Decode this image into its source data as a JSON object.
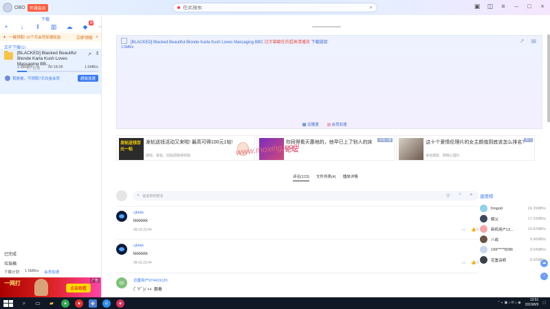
{
  "titlebar": {
    "username": "OBO",
    "vip_badge": "开通会员",
    "search_placeholder": "在此搜索"
  },
  "sidebar": {
    "top_tab": "下载",
    "notice": {
      "text": "一键领取! 10个月会员加速权益",
      "button": "立即领取"
    },
    "section_title": "正在下载(1)",
    "download": {
      "name": "[BLACKED] Blacked Beautiful Blonde Karla Kush Loves Massaging BB...",
      "size": "2.99GB",
      "count": "1个任务",
      "time": "00:18:28",
      "speed": "1.5MB/s",
      "progress": 0.12,
      "promo": "我是被，可领取7天白金会员",
      "accel_button": "超级加速"
    },
    "links": [
      "已完成",
      "垃圾箱"
    ],
    "footer": {
      "plan": "下载计划",
      "speed": "1.5MB/s",
      "vip": "会员加速"
    },
    "ad": {
      "brand": "一网打",
      "button": "点击观看",
      "badge": "广告"
    }
  },
  "player": {
    "title_prefix": "[BLACKED] Blacked Beautiful Blonde Karla Kush Loves Massaging BBC",
    "title_suffix": "比字幕翻在的超高清播放",
    "title_link": "下载链接",
    "speed": "1.5MB/s",
    "legend": [
      "远播速",
      "会员加速"
    ]
  },
  "cards": [
    {
      "title": "发帖送钱活动又来啦! 最高可得100元1帖!",
      "meta": "游戏、看帖、回帖即能得奖励",
      "thumb_text": "发帖送钱百元一帖",
      "flag": ""
    },
    {
      "title": "你同得看天惠地的，他早已上了别人的床",
      "meta": "",
      "thumb_text": "",
      "flag": "天龙八部"
    },
    {
      "title": "这十个爱情伦理片的女主颜值到底该怎么排名?",
      "meta": "来自观影  ·  网络心理片",
      "thumb_text": "",
      "flag": "热门"
    }
  ],
  "watermark": {
    "main": "www.moxing.cool",
    "top": "论坛"
  },
  "comment_tabs": [
    "评论(123)",
    "文件列表(4)",
    "播放详情"
  ],
  "comment_box": {
    "placeholder": "说说你的想法"
  },
  "comments": [
    {
      "name": "cjkkkk",
      "text": "kkkkkkk",
      "date": "08-03 23:44",
      "likes": "0"
    },
    {
      "name": "cjkkkk",
      "text": "kkkkkkk",
      "date": "08-03 23:44",
      "likes": "0"
    },
    {
      "name": "迅雷用户974419120",
      "text": "(ﾟ∀ﾟ)ﾉ 👀 跟着",
      "date": "",
      "likes": ""
    }
  ],
  "rank": {
    "title": "速度榜",
    "rows": [
      {
        "name": "fongod",
        "speed": "24.39MB/s",
        "color": "#8fd0ef"
      },
      {
        "name": "解父",
        "speed": "17.03MB/s",
        "color": "#3a4a5c"
      },
      {
        "name": "新机用户13...",
        "speed": "10.62MB/s",
        "color": "#f4a6a6"
      },
      {
        "name": "八戒",
        "speed": "9.96MB/s",
        "color": "#6a5244"
      },
      {
        "name": "199*****8286",
        "speed": "9.64MB/s",
        "color": "#c8d8ee"
      },
      {
        "name": "花重诗明",
        "speed": "8.32MB/s",
        "color": "#39404a"
      }
    ]
  },
  "taskbar": {
    "time": "13:51",
    "date": "2019/8/9"
  }
}
